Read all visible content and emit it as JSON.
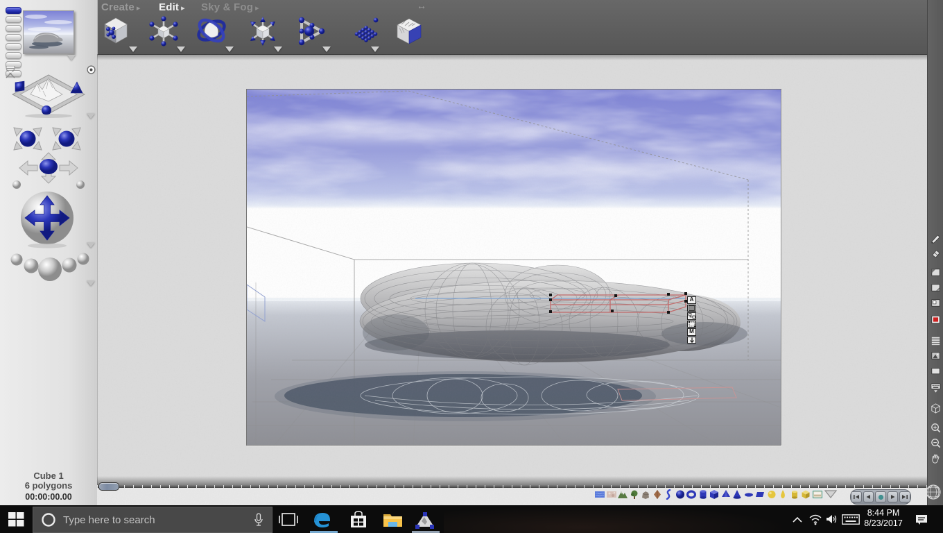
{
  "colors": {
    "accent_blue": "#2a35b8",
    "topbar_gray": "#5e5e5e",
    "canvas_gray": "#dcdcdc",
    "right_sidebar_gray": "#585858",
    "taskbar_black": "#0c0c0c",
    "selection_red": "#c26a6a",
    "record_teal": "#3d8f8f",
    "render_red": "#cc2020",
    "light_yellow": "#e8c83a"
  },
  "menubar": {
    "items": [
      {
        "label": "Create",
        "active": false
      },
      {
        "label": "Edit",
        "active": true
      },
      {
        "label": "Sky & Fog",
        "active": false
      }
    ],
    "resize_glyph": "↔"
  },
  "edit_toolbar": {
    "tools": [
      "edit-mesh",
      "resize",
      "rotate",
      "reposition",
      "align",
      "multi-replicate",
      "edit-terrain"
    ]
  },
  "left_tools": [
    "nano-preview",
    "view-pills",
    "director-view",
    "origin-dot",
    "terrain-editor-preview",
    "pan-camera-a",
    "pan-camera-b",
    "dolly-camera",
    "trackball",
    "camera-presets"
  ],
  "create_palette": [
    "water-plane",
    "cloud-plane",
    "terrain",
    "tree",
    "rock",
    "symmetrical-lattice",
    "metaball",
    "sphere",
    "torus",
    "cylinder",
    "cube",
    "pyramid",
    "cone",
    "disc",
    "plane-2d",
    "radial-light",
    "spot-light",
    "round-parallel-light",
    "square-spot-light",
    "picture-object"
  ],
  "right_toolbar": [
    "pencil",
    "eraser",
    "render-doc-a",
    "render-doc-b",
    "render-doc-c",
    "render",
    "texture-lines",
    "plop-render",
    "clear-render",
    "keyboard-shortcuts",
    "wireframe-cube",
    "zoom-in",
    "zoom-out",
    "pan-hand",
    "globe"
  ],
  "playback": {
    "buttons": [
      "skip-to-start",
      "step-back",
      "record",
      "play",
      "skip-to-end"
    ]
  },
  "selection_controls": {
    "buttons": [
      "attributes",
      "solo",
      "link",
      "resize-bounds",
      "material",
      "drop-down"
    ],
    "attributes_label": "A",
    "material_label": "M"
  },
  "status": {
    "object_name": "Cube 1",
    "polygon_count": "6 polygons",
    "timecode": "00:00:00.00"
  },
  "taskbar": {
    "search_placeholder": "Type here to search",
    "clock_time": "8:44 PM",
    "clock_date": "8/23/2017"
  }
}
